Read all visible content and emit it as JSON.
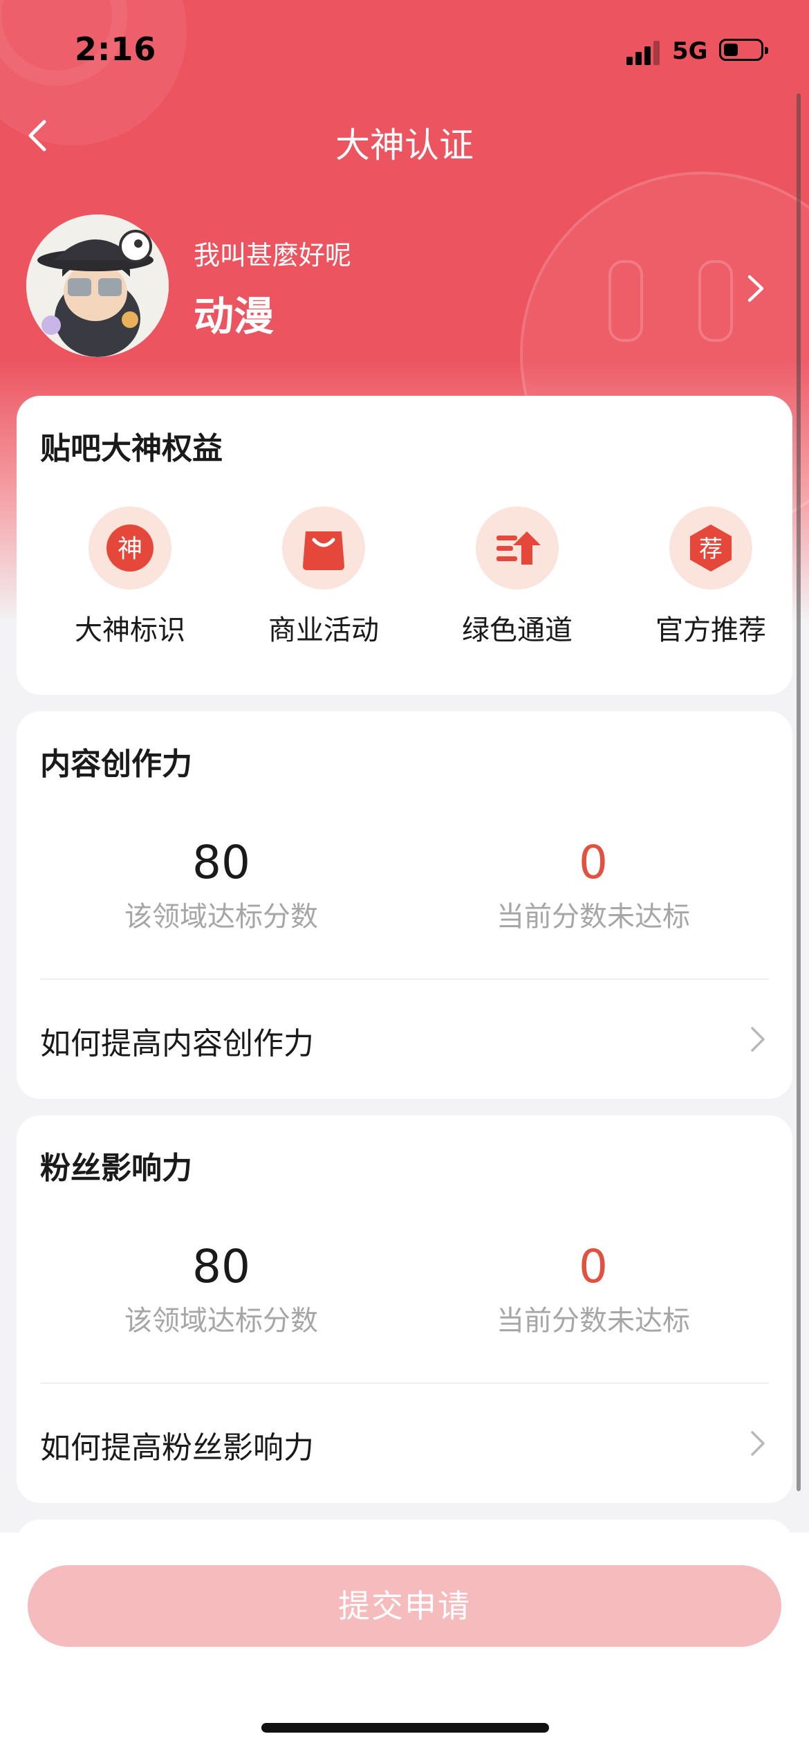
{
  "status_bar": {
    "time": "2:16",
    "network": "5G"
  },
  "nav": {
    "title": "大神认证"
  },
  "profile": {
    "username": "我叫甚麼好呢",
    "field": "动漫"
  },
  "benefits": {
    "title": "贴吧大神权益",
    "items": [
      {
        "label": "大神标识",
        "icon": "shen-badge-icon",
        "glyph": "神"
      },
      {
        "label": "商业活动",
        "icon": "shopping-bag-icon"
      },
      {
        "label": "绿色通道",
        "icon": "green-channel-arrow-icon"
      },
      {
        "label": "官方推荐",
        "icon": "recommend-badge-icon",
        "glyph": "荐"
      }
    ]
  },
  "content_creation": {
    "title": "内容创作力",
    "target_score": "80",
    "target_label": "该领域达标分数",
    "current_score": "0",
    "current_label": "当前分数未达标",
    "link": "如何提高内容创作力"
  },
  "fan_influence": {
    "title": "粉丝影响力",
    "target_score": "80",
    "target_label": "该领域达标分数",
    "current_score": "0",
    "current_label": "当前分数未达标",
    "link": "如何提高粉丝影响力"
  },
  "submit": {
    "label": "提交申请"
  },
  "colors": {
    "header": "#ec5460",
    "accent": "#e2503f",
    "icon_bg": "#fbe4db",
    "submit_disabled": "#f5bbbd",
    "muted_text": "#a6a6a6"
  }
}
